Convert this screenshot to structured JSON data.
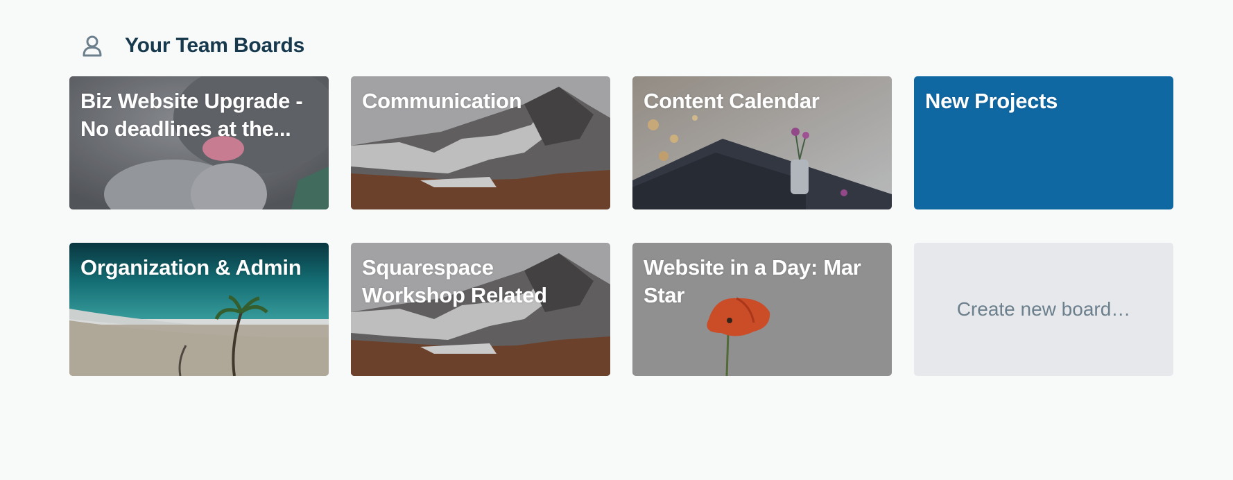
{
  "section": {
    "icon": "person-icon",
    "title": "Your Team Boards"
  },
  "boards": [
    {
      "title": "Biz Website Upgrade - No deadlines at the...",
      "background": "kitten-photo"
    },
    {
      "title": "Communication",
      "background": "mountain-photo"
    },
    {
      "title": "Content Calendar",
      "background": "flower-vase-photo"
    },
    {
      "title": "New Projects",
      "background": "solid-color",
      "color": "#1068a3"
    },
    {
      "title": "Organization & Admin",
      "background": "beach-palm-photo"
    },
    {
      "title": "Squarespace Workshop Related",
      "background": "mountain-photo"
    },
    {
      "title": "Website in a Day: Mar Star",
      "background": "poppy-photo"
    }
  ],
  "create_board": {
    "label": "Create new board…"
  },
  "colors": {
    "page_background": "#f8f9f9",
    "title_text": "#17394d",
    "create_background": "#e6e8eb",
    "create_text": "#6c7f8c"
  }
}
